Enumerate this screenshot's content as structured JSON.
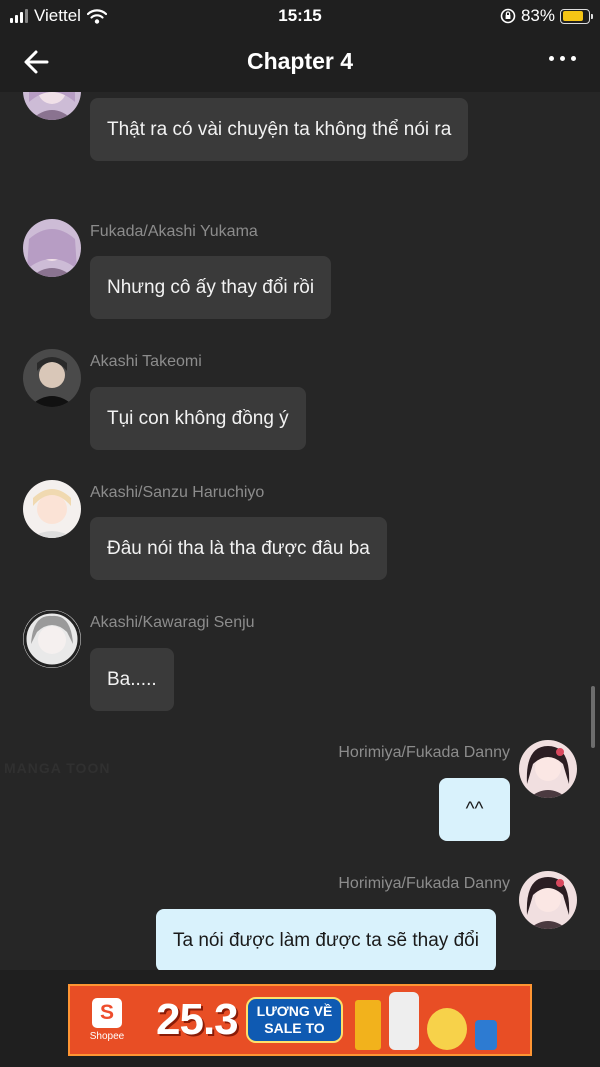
{
  "status_bar": {
    "carrier": "Viettel",
    "time": "15:15",
    "battery": "83%",
    "battery_level": 0.83
  },
  "header": {
    "title": "Chapter 4",
    "back_icon": "back-arrow-icon",
    "menu_icon": "more-horizontal-icon"
  },
  "messages": [
    {
      "author": "",
      "text": "Thật ra có vài chuyện ta không thể nói ra",
      "side": "left"
    },
    {
      "author": "Fukada/Akashi Yukama",
      "text": "Nhưng cô ấy thay đổi rồi",
      "side": "left"
    },
    {
      "author": "Akashi Takeomi",
      "text": "Tụi con không đồng ý",
      "side": "left"
    },
    {
      "author": "Akashi/Sanzu Haruchiyo",
      "text": "Đâu nói tha là tha được đâu ba",
      "side": "left"
    },
    {
      "author": "Akashi/Kawaragi Senju",
      "text": "Ba.....",
      "side": "left"
    },
    {
      "author": "Horimiya/Fukada Danny",
      "text": "^^",
      "side": "right"
    },
    {
      "author": "Horimiya/Fukada Danny",
      "text": "Ta nói được làm được ta sẽ thay đổi",
      "side": "right"
    }
  ],
  "watermark": "MANGA TOON",
  "ad": {
    "brand": "Shopee",
    "headline": "25.3",
    "slogan_line1": "LƯƠNG VỀ",
    "slogan_line2": "SALE TO"
  },
  "colors": {
    "background": "#262626",
    "bars": "#1f1f1f",
    "bubble_other": "#3a3a3a",
    "bubble_mine": "#d9f2fc",
    "name_text": "#8c8c8c",
    "battery": "#f6c515"
  }
}
